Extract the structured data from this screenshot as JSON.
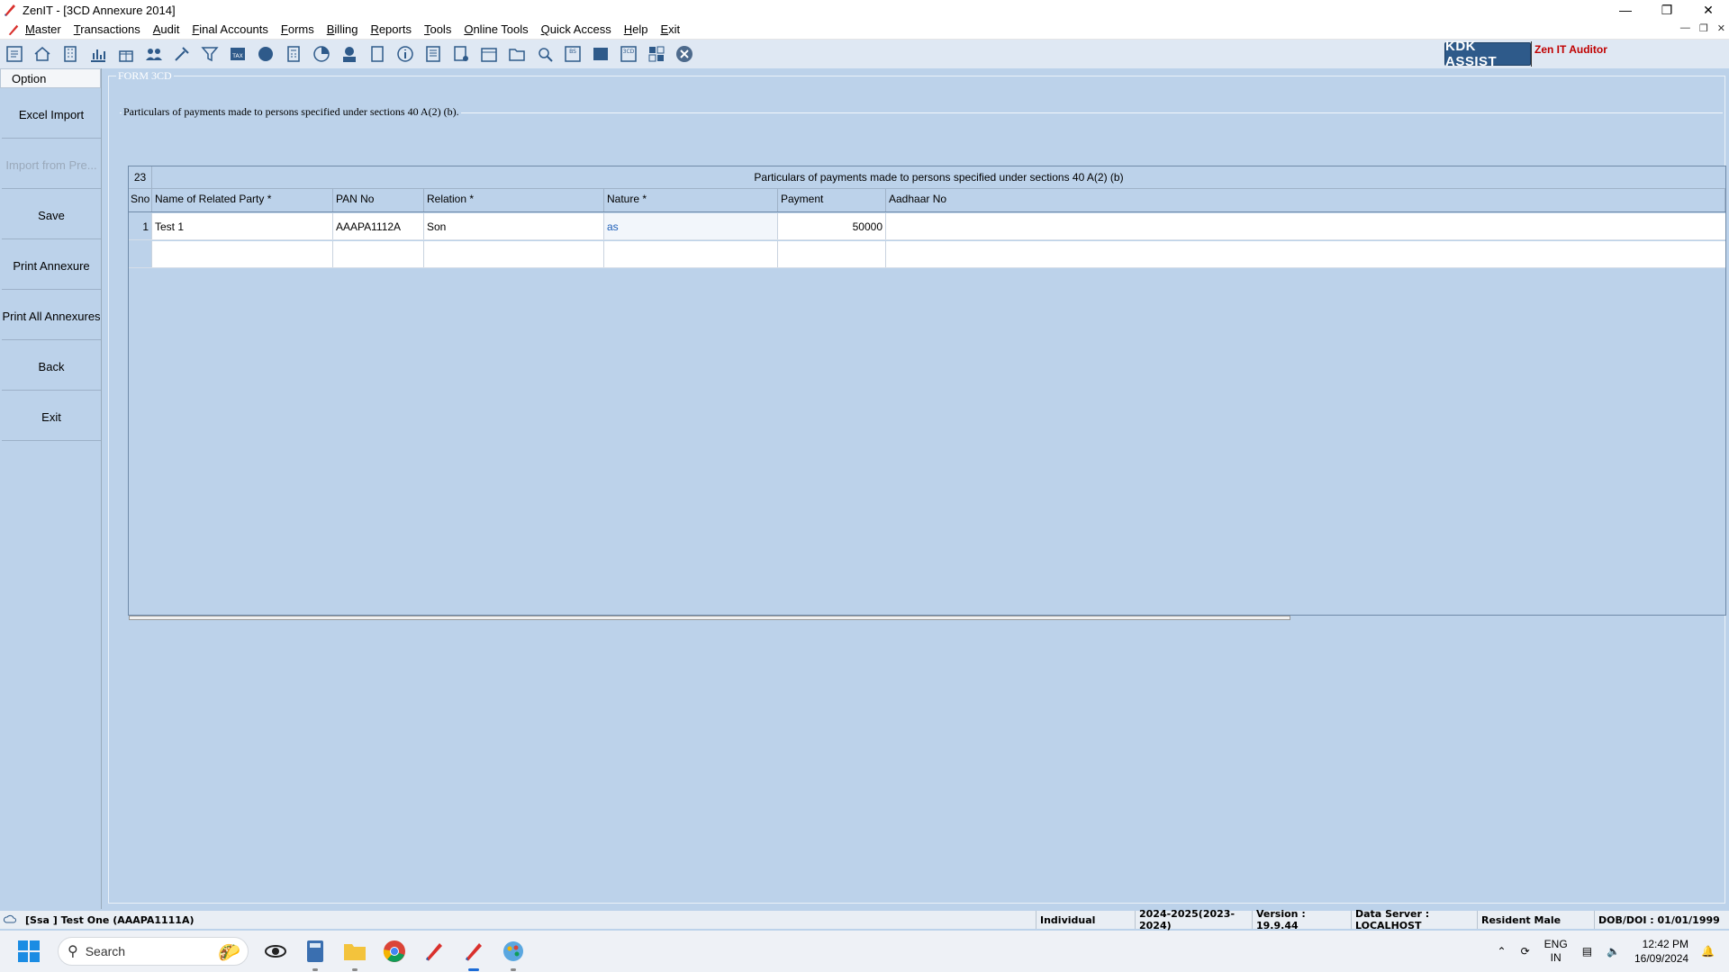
{
  "window": {
    "title": "ZenIT - [3CD Annexure 2014]"
  },
  "menu": [
    "Master",
    "Transactions",
    "Audit",
    "Final Accounts",
    "Forms",
    "Billing",
    "Reports",
    "Tools",
    "Online Tools",
    "Quick Access",
    "Help",
    "Exit"
  ],
  "brand": {
    "kdk_label": "KDK ASSIST",
    "product_label": "Zen IT Auditor"
  },
  "sidebar": {
    "header": "Option",
    "items": [
      {
        "label": "Excel Import",
        "enabled": true
      },
      {
        "label": "Import from Pre...",
        "enabled": false
      },
      {
        "label": "Save",
        "enabled": true
      },
      {
        "label": "Print Annexure",
        "enabled": true
      },
      {
        "label": "Print All Annexures",
        "enabled": true
      },
      {
        "label": "Back",
        "enabled": true
      },
      {
        "label": "Exit",
        "enabled": true
      }
    ]
  },
  "form": {
    "frame_title": "FORM 3CD",
    "section_title": "Particulars of payments made to persons specified under sections 40 A(2) (b).",
    "clause_no": "23",
    "grid_caption": "Particulars of payments made to persons specified under sections 40 A(2) (b)",
    "columns": [
      "Sno",
      "Name of Related Party *",
      "PAN No",
      "Relation *",
      "Nature *",
      "Payment",
      "Aadhaar No"
    ],
    "rows": [
      {
        "sno": "1",
        "name": "Test 1",
        "pan": "AAAPA1112A",
        "relation": "Son",
        "nature": "as",
        "payment": "50000",
        "aadhaar": ""
      }
    ]
  },
  "status": {
    "client": "[Ssa ] Test One (AAAPA1111A)",
    "status_type": "Individual",
    "year": "2024-2025(2023-2024)",
    "version": "Version : 19.9.44",
    "server": "Data Server : LOCALHOST",
    "residency": "Resident Male",
    "dob": "DOB/DOI : 01/01/1999"
  },
  "taskbar": {
    "search_placeholder": "Search",
    "lang_line1": "ENG",
    "lang_line2": "IN",
    "time": "12:42 PM",
    "date": "16/09/2024"
  },
  "colors": {
    "background": "#bcd2ea",
    "accent": "#2e5a8a",
    "brand_red": "#c00000"
  }
}
